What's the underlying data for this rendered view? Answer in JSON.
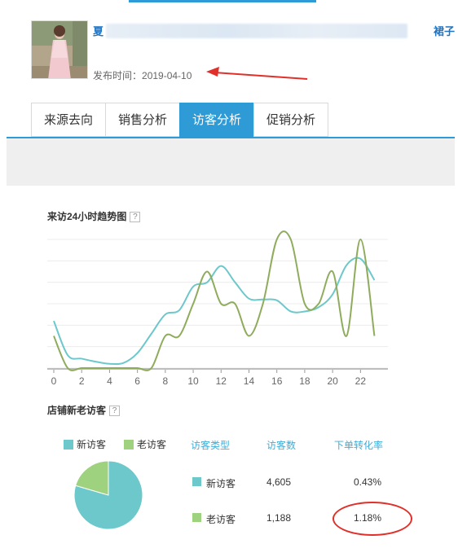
{
  "product": {
    "title_prefix": "夏",
    "title_suffix": "裙子",
    "publish_label": "发布时间：",
    "publish_date": "2019-04-10"
  },
  "tabs": [
    {
      "label": "来源去向",
      "active": false
    },
    {
      "label": "销售分析",
      "active": false
    },
    {
      "label": "访客分析",
      "active": true
    },
    {
      "label": "促销分析",
      "active": false
    }
  ],
  "trend": {
    "title": "来访24小时趋势图",
    "help": "?"
  },
  "chart_data": {
    "type": "line",
    "title": "来访24小时趋势图",
    "x": [
      0,
      1,
      2,
      3,
      4,
      5,
      6,
      7,
      8,
      9,
      10,
      11,
      12,
      13,
      14,
      15,
      16,
      17,
      18,
      19,
      20,
      21,
      22,
      23
    ],
    "x_tick_labels": [
      "0",
      "2",
      "4",
      "6",
      "8",
      "10",
      "12",
      "14",
      "16",
      "18",
      "20",
      "22"
    ],
    "ylim": [
      0,
      3
    ],
    "grid": true,
    "series": [
      {
        "color": "#6cc8cb",
        "values": [
          1.1,
          0.3,
          0.22,
          0.15,
          0.1,
          0.12,
          0.35,
          0.8,
          1.25,
          1.35,
          1.9,
          2.0,
          2.38,
          2.0,
          1.62,
          1.6,
          1.58,
          1.32,
          1.32,
          1.42,
          1.72,
          2.4,
          2.55,
          2.05
        ]
      },
      {
        "color": "#8fac5d",
        "values": [
          0.75,
          0.0,
          0.0,
          0.0,
          0.0,
          0.0,
          0.0,
          0.0,
          0.75,
          0.75,
          1.5,
          2.25,
          1.5,
          1.5,
          0.75,
          1.5,
          3.0,
          3.0,
          1.5,
          1.5,
          2.25,
          0.75,
          3.0,
          0.75
        ]
      }
    ]
  },
  "visitors": {
    "title": "店铺新老访客",
    "help": "?",
    "legend": [
      {
        "label": "新访客",
        "color": "#6cc8cb"
      },
      {
        "label": "老访客",
        "color": "#9fd27e"
      }
    ],
    "headers": {
      "type": "访客类型",
      "count": "访客数",
      "rate": "下单转化率"
    },
    "rows": [
      {
        "type": "新访客",
        "count": "4,605",
        "rate": "0.43%",
        "color": "#6cc8cb",
        "share": 0.795
      },
      {
        "type": "老访客",
        "count": "1,188",
        "rate": "1.18%",
        "color": "#9fd27e",
        "share": 0.205
      }
    ]
  },
  "colors": {
    "accent": "#2e9ad6",
    "annotation": "#e1302a"
  }
}
